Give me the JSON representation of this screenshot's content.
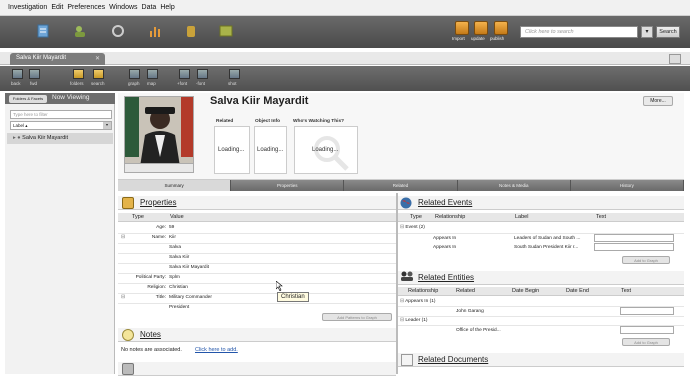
{
  "menu": [
    "Investigation",
    "Edit",
    "Preferences",
    "Windows",
    "Data",
    "Help"
  ],
  "main_toolbar": {
    "buttons": [
      {
        "label": "Import"
      },
      {
        "label": "update"
      },
      {
        "label": "publish"
      }
    ],
    "search_placeholder": "Click here to search",
    "search_button": "Search"
  },
  "document_tab": {
    "title": "Salva Kiir Mayardit",
    "close": "✕"
  },
  "toolbar2": {
    "items": [
      {
        "label": "back"
      },
      {
        "label": "fwd"
      },
      {
        "label": "folders"
      },
      {
        "label": "search"
      },
      {
        "label": "graph"
      },
      {
        "label": "map"
      },
      {
        "label": "+font"
      },
      {
        "label": "-font"
      },
      {
        "label": "shot"
      }
    ]
  },
  "left_panel": {
    "folder_button": "Folders & Facets",
    "now_viewing": "Now Viewing",
    "filter_placeholder": "Type here to filter",
    "label_select": "Label",
    "tree_item": "Salva Kiir Mayardit"
  },
  "entity": {
    "title": "Salva Kiir Mayardit",
    "more_button": "More...",
    "cards": [
      {
        "label": "Related",
        "status": "Loading..."
      },
      {
        "label": "Object Info",
        "status": "Loading..."
      },
      {
        "label": "Who's Watching This?",
        "status": "Loading..."
      }
    ]
  },
  "tabs": [
    "Summary",
    "Properties",
    "Related",
    "Notes & Media",
    "History"
  ],
  "properties": {
    "title": "Properties",
    "columns": [
      "Type",
      "Value"
    ],
    "rows": [
      {
        "key": "Age:",
        "value": "59"
      },
      {
        "key": "Name:",
        "value": "Kiir"
      },
      {
        "key": "",
        "value": "Salva"
      },
      {
        "key": "",
        "value": "Salva Kiir"
      },
      {
        "key": "",
        "value": "Salva Kiir Mayardit"
      },
      {
        "key": "Political Party:",
        "value": "Splm"
      },
      {
        "key": "Religion:",
        "value": "Christian"
      },
      {
        "key": "Title:",
        "value": "Military Commander"
      },
      {
        "key": "",
        "value": "President"
      }
    ],
    "add_button": "Add Patterns to Graph",
    "tooltip": "Christian"
  },
  "notes": {
    "title": "Notes",
    "empty_text": "No notes are associated.",
    "add_link": "Click here to add."
  },
  "related_events": {
    "title": "Related Events",
    "columns": [
      "Type",
      "Relationship",
      "Label",
      "Text"
    ],
    "group": "Event (2)",
    "rows": [
      {
        "relationship": "Appears In",
        "label": "Leaders of Sudan and South ..."
      },
      {
        "relationship": "Appears In",
        "label": "South Sudan President Kiir r..."
      }
    ],
    "add_button": "Add to Graph"
  },
  "related_entities": {
    "title": "Related Entities",
    "columns": [
      "Relationship",
      "Related",
      "Date Begin",
      "Date End",
      "Text"
    ],
    "groups": [
      {
        "name": "Appears In (1)",
        "related": "John Garang"
      },
      {
        "name": "Leader (1)",
        "related": "Office of the Presid..."
      }
    ],
    "add_button": "Add to Graph"
  },
  "related_documents": {
    "title": "Related Documents"
  },
  "colors": {
    "toolbar": "#5a5a5a",
    "accent": "#f0a33a",
    "background": "#ffffff"
  }
}
